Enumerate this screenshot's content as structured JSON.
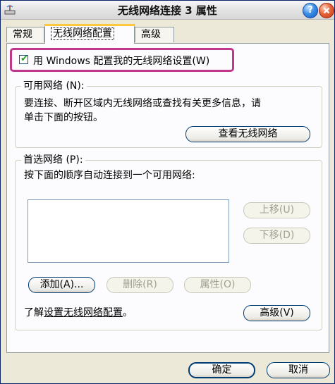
{
  "window": {
    "title": "无线网络连接 3 属性",
    "help_label": "?"
  },
  "tabs": [
    {
      "label": "常规"
    },
    {
      "label": "无线网络配置"
    },
    {
      "label": "高级"
    }
  ],
  "use_windows": {
    "label": "用 Windows 配置我的无线网络设置(W)",
    "checked": true
  },
  "available": {
    "group_label": "可用网络 (N):",
    "desc_line1": "要连接、断开区域内无线网络或查找有关更多信息，请",
    "desc_line2": "单击下面的按钮。",
    "view_button": "查看无线网络"
  },
  "preferred": {
    "group_label": "首选网络 (P):",
    "desc": "按下面的顺序自动连接到一个可用网络:",
    "move_up": "上移(U)",
    "move_down": "下移(D)",
    "add": "添加(A)...",
    "remove": "删除(R)",
    "properties": "属性(O)"
  },
  "learn": {
    "prefix": "了解",
    "link": "设置无线网络配置",
    "suffix": "。"
  },
  "advanced_button": "高级(V)",
  "ok_button": "确定",
  "cancel_button": "取消",
  "colors": {
    "highlight": "#c0368c",
    "tab_accent": "#ffc83c"
  }
}
